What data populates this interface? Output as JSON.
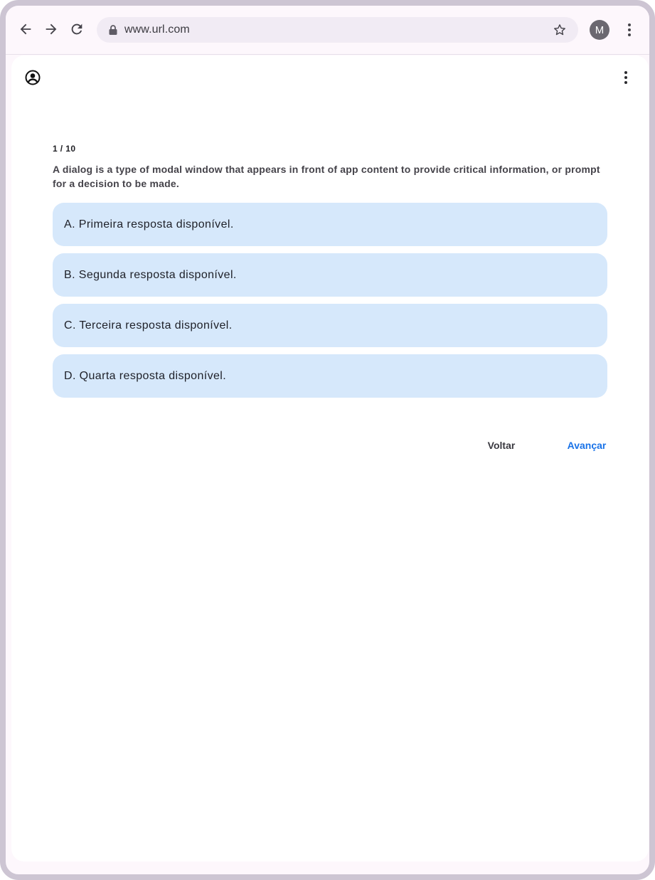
{
  "browser": {
    "url": "www.url.com",
    "avatar_letter": "M",
    "icons": {
      "back": "arrow-back-icon",
      "forward": "arrow-forward-icon",
      "reload": "reload-icon",
      "lock": "lock-icon",
      "bookmark": "star-icon",
      "menu": "more-vert-icon"
    }
  },
  "app": {
    "icons": {
      "account": "account-circle-icon",
      "menu": "more-vert-icon"
    },
    "quiz": {
      "progress": "1 / 10",
      "question": "A dialog is a type of modal window that appears in front of app content to provide critical information, or prompt for a decision to be made.",
      "answers": [
        {
          "label": "A. Primeira resposta disponível."
        },
        {
          "label": "B. Segunda resposta disponível."
        },
        {
          "label": "C. Terceira resposta disponível."
        },
        {
          "label": "D. Quarta resposta disponível."
        }
      ],
      "back_label": "Voltar",
      "next_label": "Avançar"
    }
  },
  "colors": {
    "frame": "#cdc5d3",
    "answer_bg": "#d6e8fb",
    "primary": "#1a73e8",
    "urlbar_bg": "#f1ebf4"
  }
}
